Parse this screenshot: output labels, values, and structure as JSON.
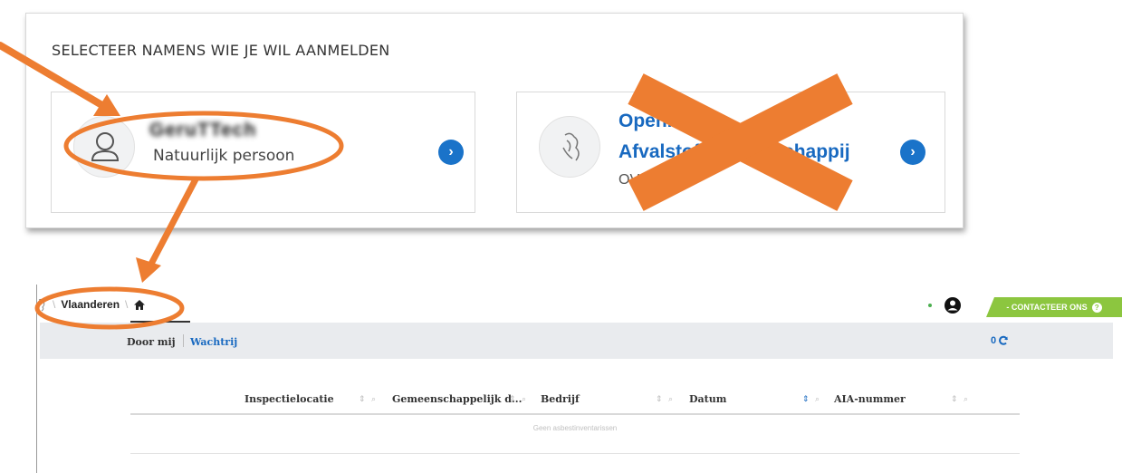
{
  "login": {
    "title": "SELECTEER NAMENS WIE JE WIL AANMELDEN",
    "cards": [
      {
        "name": "GeruTTech",
        "subtitle": "Natuurlijk persoon",
        "icon": "user-icon"
      },
      {
        "org_line1": "Openbare",
        "org_line2": "Afvalstoffenmaatschappij",
        "org_line3": "OVAM0001",
        "icon": "flemish-lion-icon"
      }
    ],
    "action_icon": "chevron-right-icon"
  },
  "app": {
    "breadcrumb": {
      "root": "Vlaanderen",
      "home_icon": "home-icon"
    },
    "user_icon": "account-circle-icon",
    "contact": {
      "label": "- CONTACTEER ONS",
      "icon": "help-icon"
    },
    "subnav": {
      "mine": "Door mij",
      "queue": "Wachtrij",
      "count": "0"
    },
    "table": {
      "columns": [
        "Inspectielocatie",
        "Gemeenschappelijk d...",
        "Bedrijf",
        "Datum",
        "AIA-nummer"
      ],
      "empty_message": "Geen asbestinventarissen"
    }
  },
  "colors": {
    "accent": "#1a73c9",
    "annotation": "#ed7d31",
    "contact": "#8cc63f"
  }
}
